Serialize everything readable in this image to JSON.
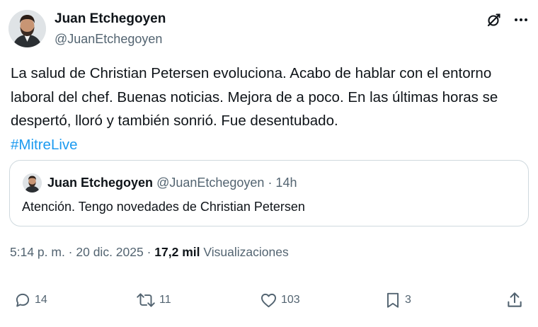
{
  "author": {
    "name": "Juan Etchegoyen",
    "handle": "@JuanEtchegoyen"
  },
  "icons": {
    "grok": "slashed-circle-icon",
    "more": "more-dots-icon"
  },
  "tweet": {
    "body": "La salud de Christian Petersen evoluciona. Acabo de hablar con el entorno laboral del chef. Buenas noticias. Mejora de a poco. En las últimas horas se despertó, lloró y también sonrió. Fue desentubado.",
    "hashtag": "#MitreLive",
    "hashtag_color": "#1d9bf0"
  },
  "quote": {
    "name": "Juan Etchegoyen",
    "meta": "@JuanEtchegoyen · 14h",
    "text": "Atención. Tengo novedades de Christian Petersen"
  },
  "stamp": {
    "time_date": "5:14 p. m. · 20 dic. 2025 ·",
    "views_count": "17,2 mil",
    "views_label": "Visualizaciones"
  },
  "actions": {
    "replies": "14",
    "reposts": "11",
    "likes": "103",
    "bookmarks": "3"
  },
  "colors": {
    "text": "#0f1419",
    "secondary": "#536471",
    "border": "#cfd9de",
    "accent": "#1d9bf0"
  }
}
